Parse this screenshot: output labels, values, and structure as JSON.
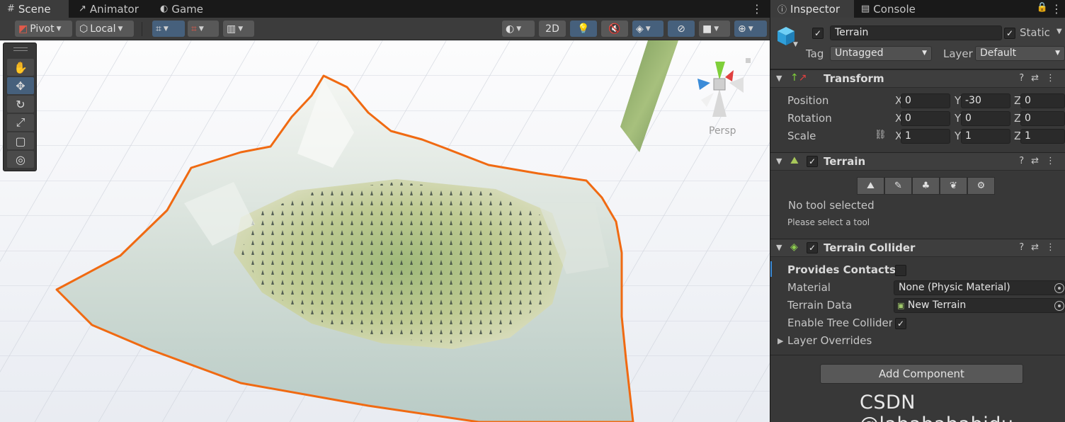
{
  "scene_tabs": [
    {
      "label": "Scene",
      "icon": "grid-icon"
    },
    {
      "label": "Animator",
      "icon": "animator-icon"
    },
    {
      "label": "Game",
      "icon": "gamepad-icon"
    }
  ],
  "toolbar": {
    "pivot_label": "Pivot",
    "local_label": "Local",
    "two_d_label": "2D"
  },
  "viewport": {
    "camera_mode": "Persp"
  },
  "tools": [
    "hand-tool",
    "move-tool",
    "rotate-tool",
    "scale-tool",
    "rect-tool",
    "transform-tool"
  ],
  "inspector_tabs": [
    {
      "label": "Inspector",
      "icon": "info-icon"
    },
    {
      "label": "Console",
      "icon": "console-icon"
    }
  ],
  "gameobject": {
    "name": "Terrain",
    "static_label": "Static",
    "tag_label": "Tag",
    "tag_value": "Untagged",
    "layer_label": "Layer",
    "layer_value": "Default"
  },
  "transform": {
    "title": "Transform",
    "position_label": "Position",
    "rotation_label": "Rotation",
    "scale_label": "Scale",
    "position": {
      "x": "0",
      "y": "-30",
      "z": "0"
    },
    "rotation": {
      "x": "0",
      "y": "0",
      "z": "0"
    },
    "scale": {
      "x": "1",
      "y": "1",
      "z": "1"
    },
    "axis_x": "X",
    "axis_y": "Y",
    "axis_z": "Z"
  },
  "terrain": {
    "title": "Terrain",
    "no_tool": "No tool selected",
    "please_select": "Please select a tool"
  },
  "collider": {
    "title": "Terrain Collider",
    "provides_contacts": "Provides Contacts",
    "material_label": "Material",
    "material_value": "None (Physic Material)",
    "terrain_data_label": "Terrain Data",
    "terrain_data_value": "New Terrain",
    "enable_tree_label": "Enable Tree Colliders",
    "layer_overrides": "Layer Overrides"
  },
  "add_component": "Add Component",
  "watermark": "CSDN @lababababidu",
  "colors": {
    "selection_outline": "#f06a12",
    "active_blue": "#46607c",
    "panel_bg": "#383838"
  }
}
